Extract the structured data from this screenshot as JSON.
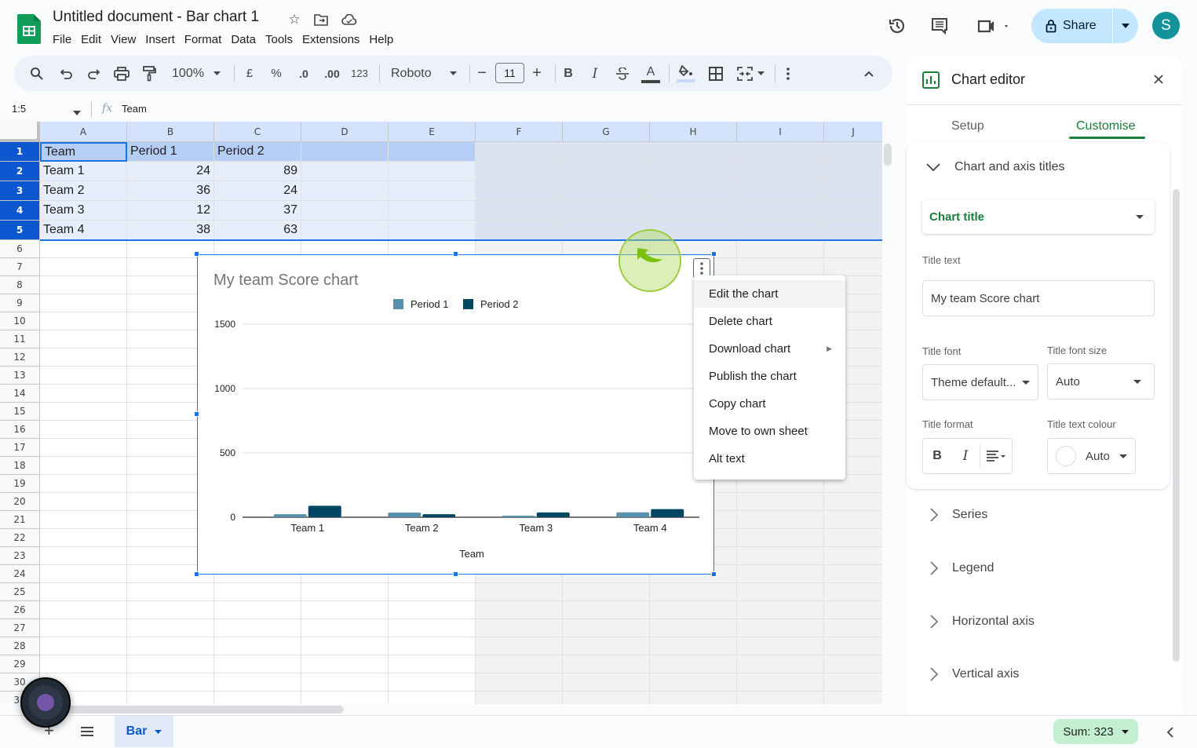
{
  "app": {
    "doc_title": "Untitled document - Bar chart 1",
    "menu": [
      "File",
      "Edit",
      "View",
      "Insert",
      "Format",
      "Data",
      "Tools",
      "Extensions",
      "Help"
    ],
    "share_label": "Share",
    "avatar_initial": "S",
    "brand_color": "#0f9d58"
  },
  "toolbar": {
    "zoom": "100%",
    "currency": "£",
    "percent": "%",
    "dec_decrease": ".0",
    "dec_increase": ".00",
    "number_format": "123",
    "font": "Roboto",
    "font_size": "11",
    "bold": "B",
    "italic": "I",
    "text_color": "A"
  },
  "formula_bar": {
    "name_box": "1:5",
    "fx": "fx",
    "value": "Team"
  },
  "grid": {
    "columns": [
      "A",
      "B",
      "C",
      "D",
      "E",
      "F",
      "G",
      "H",
      "I",
      "J"
    ],
    "rows": [
      "1",
      "2",
      "3",
      "4",
      "5",
      "6",
      "7",
      "8",
      "9",
      "10",
      "11",
      "12",
      "13",
      "14",
      "15",
      "16",
      "17",
      "18",
      "19",
      "20",
      "21",
      "22",
      "23",
      "24",
      "25",
      "26",
      "27",
      "28",
      "29",
      "30",
      "31"
    ],
    "cells": [
      [
        "Team",
        "Period 1",
        "Period 2"
      ],
      [
        "Team 1",
        "24",
        "89"
      ],
      [
        "Team 2",
        "36",
        "24"
      ],
      [
        "Team 3",
        "12",
        "37"
      ],
      [
        "Team 4",
        "38",
        "63"
      ]
    ]
  },
  "chart_data": {
    "type": "bar",
    "title": "My team Score chart",
    "categories": [
      "Team 1",
      "Team 2",
      "Team 3",
      "Team 4"
    ],
    "series": [
      {
        "name": "Period 1",
        "values": [
          24,
          36,
          12,
          38
        ],
        "color": "#5891ad"
      },
      {
        "name": "Period 2",
        "values": [
          89,
          24,
          37,
          63
        ],
        "color": "#004561"
      }
    ],
    "xlabel": "Team",
    "ylabel": "",
    "ylim": [
      0,
      1500
    ],
    "yticks": [
      "0",
      "500",
      "1000",
      "1500"
    ],
    "grid": true,
    "legend": "top"
  },
  "context_menu": {
    "items": [
      "Edit the chart",
      "Delete chart",
      "Download chart",
      "Publish the chart",
      "Copy chart",
      "Move to own sheet",
      "Alt text"
    ]
  },
  "chart_editor": {
    "title": "Chart editor",
    "tabs": [
      "Setup",
      "Customise"
    ],
    "active_tab": "Customise",
    "section_open": "Chart and axis titles",
    "title_type": "Chart title",
    "title_text_label": "Title text",
    "title_text_value": "My team Score chart",
    "title_font_label": "Title font",
    "title_font_value": "Theme default...",
    "title_font_size_label": "Title font size",
    "title_font_size_value": "Auto",
    "title_format_label": "Title format",
    "title_color_label": "Title text colour",
    "title_color_value": "Auto",
    "collapsed_sections": [
      "Series",
      "Legend",
      "Horizontal axis",
      "Vertical axis"
    ]
  },
  "bottom": {
    "sheet_tab": "Bar",
    "sum": "Sum: 323"
  }
}
